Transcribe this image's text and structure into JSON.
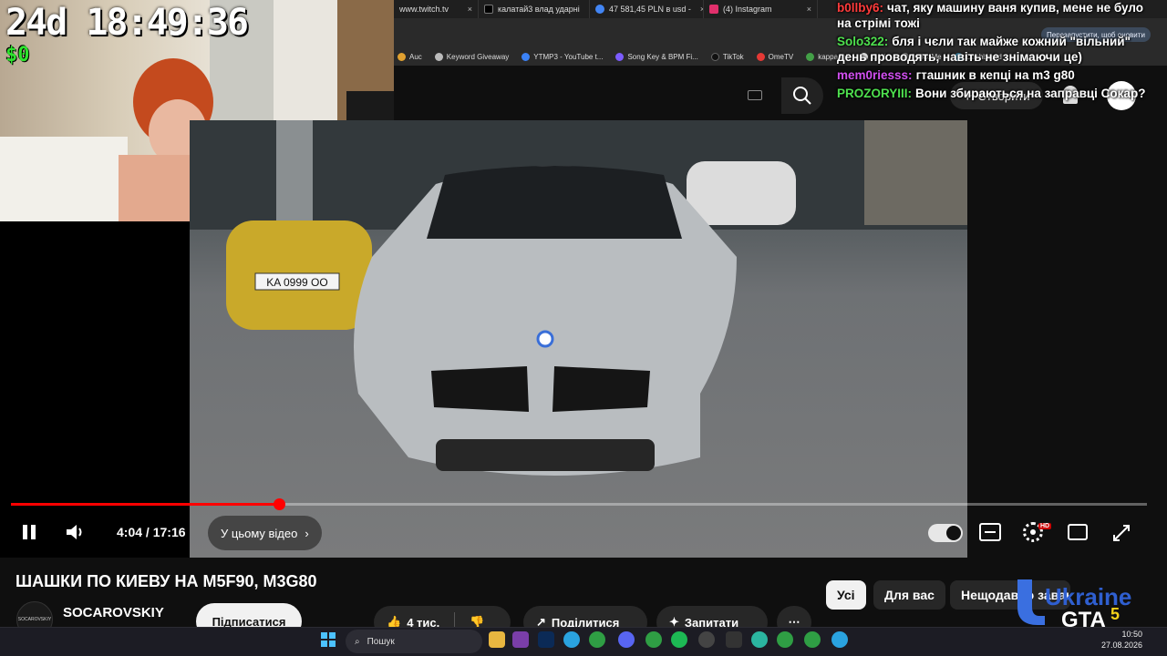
{
  "browser": {
    "tabs": [
      {
        "label": "www.twitch.tv",
        "color": "#9146ff"
      },
      {
        "label": "калатай3 влад ударнi",
        "color": "#000000"
      },
      {
        "label": "47 581,45 PLN в usd -",
        "color": "#4285f4"
      },
      {
        "label": "(4) Instagram",
        "color": "#e1306c"
      }
    ],
    "close_glyph": "×",
    "restart_label": "Перезапустити, щоб оновити",
    "bookmarks": [
      {
        "label": "Auc",
        "color": "#e0a030"
      },
      {
        "label": "Keyword Giveaway",
        "color": "#bbbbbb"
      },
      {
        "label": "YTMP3 - YouTube t...",
        "color": "#3b82f6"
      },
      {
        "label": "Song Key & BPM Fi...",
        "color": "#7c5cff"
      },
      {
        "label": "TikTok",
        "color": "#111111"
      },
      {
        "label": "OmeTV",
        "color": "#e53935"
      },
      {
        "label": "kappa.lol",
        "color": "#43a047"
      },
      {
        "label": "Grok",
        "color": "#dddddd"
      },
      {
        "label": "NektoMe",
        "color": "#888888"
      },
      {
        "label": "Dashboard",
        "color": "#4fc3f7"
      }
    ]
  },
  "webcam": {
    "timer": "24d 18:49:36",
    "money": "$0"
  },
  "chat": [
    {
      "user": "b0llby6:",
      "user_color": "#ff3b3b",
      "text": "чат, яку машину ваня купив, мене не було на стрімі тожі"
    },
    {
      "user": "Solo322:",
      "user_color": "#4ee04e",
      "text": "бля і чєли так майже кожний \"вільний\" день проводять, навіть не знімаючи це)"
    },
    {
      "user": "mem0riesss:",
      "user_color": "#d14ff0",
      "text": "гташник в кепці на m3 g80"
    },
    {
      "user": "PROZORYIII:",
      "user_color": "#4ee04e",
      "text": "Вони збираються на заправці Сокар?"
    }
  ],
  "youtube": {
    "create_label": "Створити",
    "player": {
      "current_time": "4:04",
      "separator": " / ",
      "duration": "17:16",
      "progress_fraction": 0.236,
      "chapter_label": "У цьому відео",
      "hd_badge": "HD"
    },
    "video_title": "ШАШКИ ПО КИЕВУ НА M5F90, M3G80",
    "channel": {
      "name": "SOCAROVSKIY",
      "avatar_text": "SOCAROVSKIY",
      "subscribe_label": "Підписатися"
    },
    "actions": {
      "likes": "4 тис.",
      "share": "Поділитися",
      "ask": "Запитати"
    },
    "filter_chips": [
      "Усі",
      "Для вас",
      "Нещодавно завантажені"
    ]
  },
  "video_scene": {
    "plate": "KA 0999 OO"
  },
  "overlay_logo": {
    "line1": "Ukraine",
    "line2": "GTA",
    "number": "5"
  },
  "taskbar": {
    "search_placeholder": "Пошук",
    "time": "10:50",
    "date": "27.08.2026"
  }
}
